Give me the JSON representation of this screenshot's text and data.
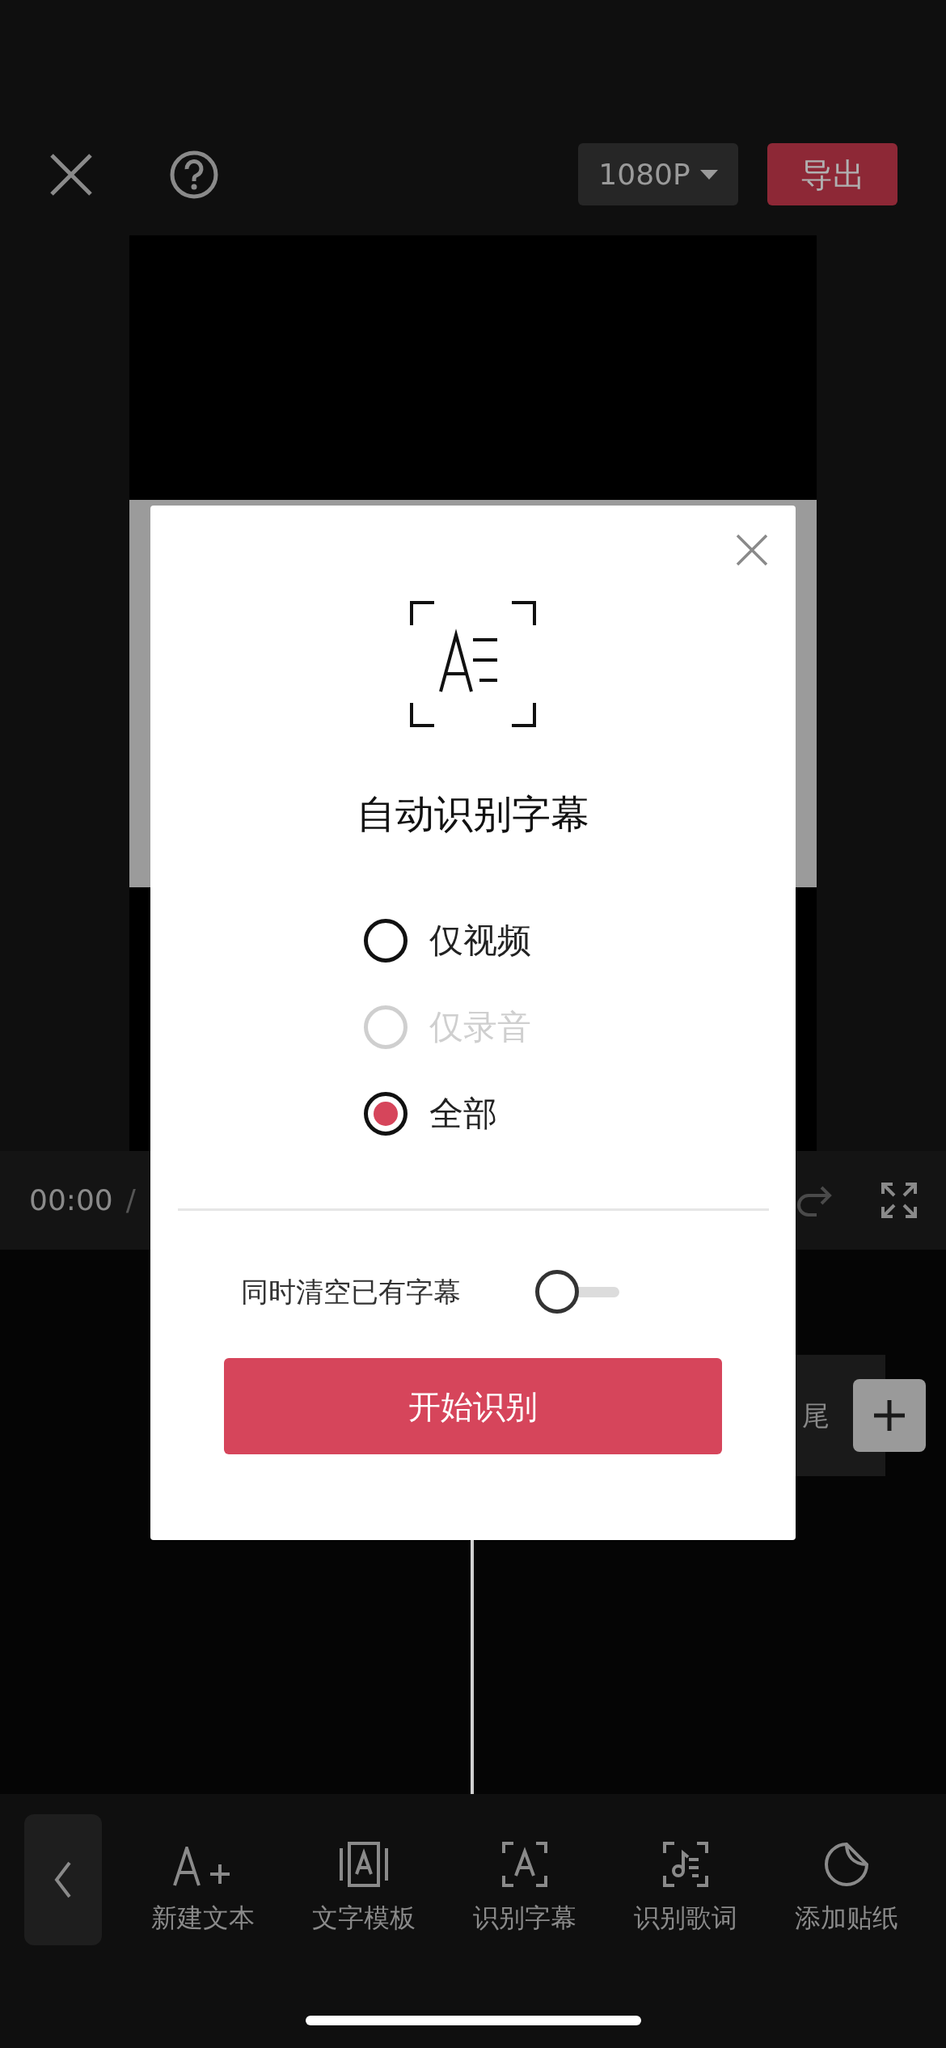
{
  "top_bar": {
    "resolution": "1080P",
    "export": "导出"
  },
  "playback": {
    "current_time": "00:00",
    "separator": "/"
  },
  "timeline": {
    "clip_label": "尾"
  },
  "dialog": {
    "title": "自动识别字幕",
    "options": [
      {
        "label": "仅视频",
        "selected": false,
        "disabled": false
      },
      {
        "label": "仅录音",
        "selected": false,
        "disabled": true
      },
      {
        "label": "全部",
        "selected": true,
        "disabled": false
      }
    ],
    "toggle": {
      "label": "同时清空已有字幕",
      "on": false
    },
    "button": "开始识别"
  },
  "toolbar": [
    {
      "label": "新建文本"
    },
    {
      "label": "文字模板"
    },
    {
      "label": "识别字幕"
    },
    {
      "label": "识别歌词"
    },
    {
      "label": "添加贴纸"
    }
  ]
}
